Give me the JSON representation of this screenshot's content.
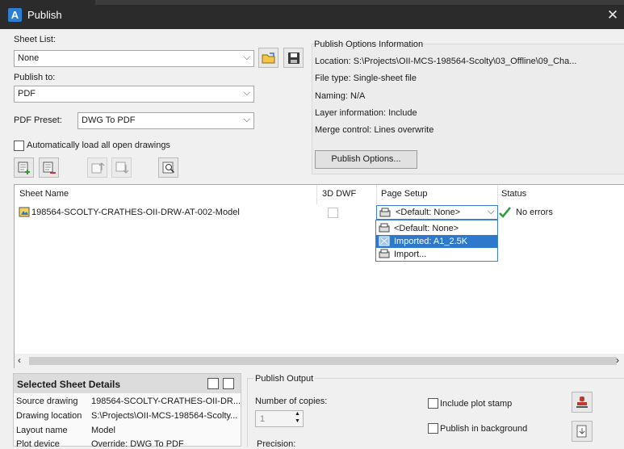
{
  "window": {
    "title": "Publish",
    "app_icon": "A",
    "close_glyph": "✕"
  },
  "sheet_list": {
    "label": "Sheet List:",
    "value": "None"
  },
  "publish_to": {
    "label": "Publish to:",
    "value": "PDF"
  },
  "pdf_preset": {
    "label": "PDF Preset:",
    "value": "DWG To PDF"
  },
  "auto_load": {
    "label": "Automatically load all open drawings",
    "checked": false
  },
  "options_info": {
    "title": "Publish Options Information",
    "location": "Location: S:\\Projects\\OII-MCS-198564-Scolty\\03_Offline\\09_Cha...",
    "file_type": "File type: Single-sheet file",
    "naming": "Naming: N/A",
    "layer_info": "Layer information: Include",
    "merge": "Merge control: Lines overwrite",
    "button": "Publish Options..."
  },
  "table": {
    "headers": [
      "Sheet Name",
      "3D DWF",
      "Page Setup",
      "Status"
    ],
    "rows": [
      {
        "sheet_name": "198564-SCOLTY-CRATHES-OII-DRW-AT-002-Model",
        "page_setup": "<Default: None>",
        "status": "No errors"
      }
    ],
    "dropdown_options": [
      "<Default: None>",
      "Imported: A1_2.5K",
      "Import..."
    ]
  },
  "details": {
    "title": "Selected Sheet Details",
    "rows": [
      {
        "label": "Source drawing",
        "value": "198564-SCOLTY-CRATHES-OII-DR..."
      },
      {
        "label": "Drawing location",
        "value": "S:\\Projects\\OII-MCS-198564-Scolty..."
      },
      {
        "label": "Layout name",
        "value": "Model"
      },
      {
        "label": "Plot device",
        "value": "Override: DWG To PDF"
      }
    ]
  },
  "output": {
    "title": "Publish Output",
    "copies_label": "Number of copies:",
    "copies_value": "1",
    "precision_label": "Precision:",
    "plot_stamp": "Include plot stamp",
    "background": "Publish in background"
  },
  "colors": {
    "accent": "#2f79cd",
    "titlebar": "#2b2b2b",
    "ok": "#2e9a3c"
  }
}
